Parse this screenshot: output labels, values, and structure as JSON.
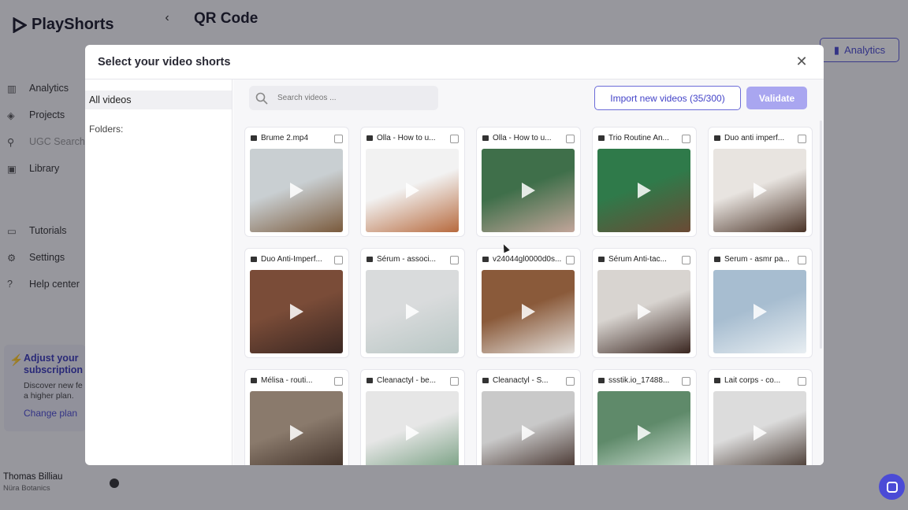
{
  "app": {
    "logo_text": "PlayShorts",
    "page_title": "QR Code",
    "analytics_button": "Analytics"
  },
  "sidebar": {
    "items": [
      {
        "label": "Analytics",
        "icon": "bar-chart-icon"
      },
      {
        "label": "Projects",
        "icon": "layers-icon"
      },
      {
        "label": "UGC Search",
        "icon": "person-search-icon"
      },
      {
        "label": "Library",
        "icon": "image-icon"
      },
      {
        "label": "Tutorials",
        "icon": "video-icon"
      },
      {
        "label": "Settings",
        "icon": "gear-icon"
      },
      {
        "label": "Help center",
        "icon": "help-icon"
      }
    ],
    "subscription": {
      "title": "Adjust your subscription",
      "description": "Discover new fe a higher plan.",
      "link": "Change plan"
    },
    "user": {
      "name": "Thomas Billiau",
      "org": "Nüra Botanics"
    }
  },
  "modal": {
    "title": "Select your video shorts",
    "side": {
      "all_videos": "All videos",
      "folders": "Folders:"
    },
    "search_placeholder": "Search videos ...",
    "import_button": "Import new videos (35/300)",
    "validate_button": "Validate",
    "videos": [
      {
        "name": "Brume 2.mp4",
        "colors": [
          "#c9cfd2",
          "#7a5a3c"
        ]
      },
      {
        "name": "Olla - How to u...",
        "colors": [
          "#f2f2f2",
          "#b76a3e"
        ]
      },
      {
        "name": "Olla - How to u...",
        "colors": [
          "#3f6f4a",
          "#c2a59a"
        ]
      },
      {
        "name": "Trio Routine An...",
        "colors": [
          "#2f7a4a",
          "#6b4a35"
        ]
      },
      {
        "name": "Duo anti imperf...",
        "colors": [
          "#e8e4e0",
          "#4a3327"
        ]
      },
      {
        "name": "Duo Anti-Imperf...",
        "colors": [
          "#7a4c38",
          "#3a2722"
        ]
      },
      {
        "name": "Sérum - associ...",
        "colors": [
          "#d9dbdc",
          "#b8c6c4"
        ]
      },
      {
        "name": "v24044gl0000d0s...",
        "colors": [
          "#8a5a3a",
          "#e4e0dc"
        ]
      },
      {
        "name": "Sérum Anti-tac...",
        "colors": [
          "#d8d4d0",
          "#3a2620"
        ]
      },
      {
        "name": "Serum - asmr pa...",
        "colors": [
          "#a7bdd0",
          "#e8eef2"
        ]
      },
      {
        "name": "Mélisa - routi...",
        "colors": [
          "#8a7a6c",
          "#3a2a22"
        ]
      },
      {
        "name": "Cleanactyl - be...",
        "colors": [
          "#e6e6e6",
          "#6f9a7a"
        ]
      },
      {
        "name": "Cleanactyl - S...",
        "colors": [
          "#c9c9c9",
          "#3a2620"
        ]
      },
      {
        "name": "ssstik.io_17488...",
        "colors": [
          "#5f8a6a",
          "#d6e6dc"
        ]
      },
      {
        "name": "Lait corps - co...",
        "colors": [
          "#dcdcdc",
          "#3a2a22"
        ]
      }
    ]
  }
}
